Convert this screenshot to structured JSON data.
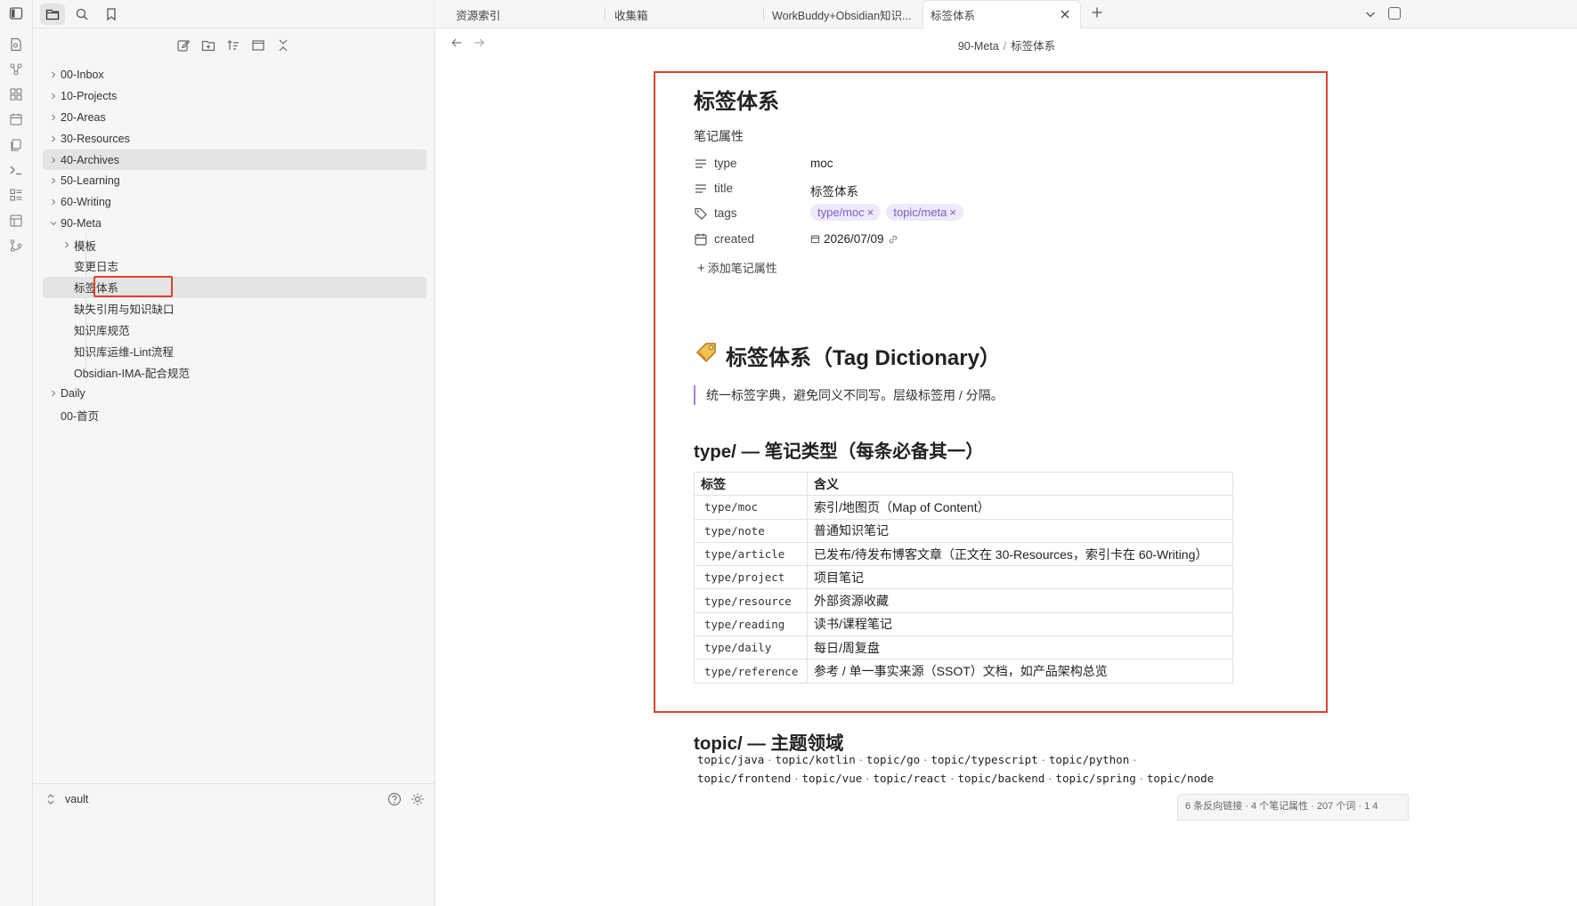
{
  "sidebar": {
    "tree": [
      {
        "label": "00-Inbox",
        "type": "folder",
        "expanded": false
      },
      {
        "label": "10-Projects",
        "type": "folder",
        "expanded": false
      },
      {
        "label": "20-Areas",
        "type": "folder",
        "expanded": false
      },
      {
        "label": "30-Resources",
        "type": "folder",
        "expanded": false
      },
      {
        "label": "40-Archives",
        "type": "folder",
        "expanded": false,
        "selected": true
      },
      {
        "label": "50-Learning",
        "type": "folder",
        "expanded": false
      },
      {
        "label": "60-Writing",
        "type": "folder",
        "expanded": false
      },
      {
        "label": "90-Meta",
        "type": "folder",
        "expanded": true
      },
      {
        "label": "模板",
        "type": "folder",
        "expanded": false,
        "child": true
      },
      {
        "label": "变更日志",
        "type": "file",
        "child": true
      },
      {
        "label": "标签体系",
        "type": "file",
        "child": true,
        "active": true
      },
      {
        "label": "缺失引用与知识缺口",
        "type": "file",
        "child": true
      },
      {
        "label": "知识库规范",
        "type": "file",
        "child": true
      },
      {
        "label": "知识库运维-Lint流程",
        "type": "file",
        "child": true
      },
      {
        "label": "Obsidian-IMA-配合规范",
        "type": "file",
        "child": true
      },
      {
        "label": "Daily",
        "type": "folder",
        "expanded": false
      },
      {
        "label": "00-首页",
        "type": "file"
      }
    ],
    "vault_name": "vault"
  },
  "tabs": [
    {
      "label": "资源索引"
    },
    {
      "label": "收集箱"
    },
    {
      "label": "WorkBuddy+Obsidian知识..."
    },
    {
      "label": "标签体系",
      "active": true
    }
  ],
  "breadcrumb": {
    "folder": "90-Meta",
    "separator": "/",
    "file": "标签体系"
  },
  "note": {
    "title": "标签体系",
    "properties_heading": "笔记属性",
    "properties": {
      "type": {
        "key": "type",
        "value": "moc"
      },
      "title": {
        "key": "title",
        "value": "标签体系"
      },
      "tags": {
        "key": "tags",
        "values": [
          "type/moc",
          "topic/meta"
        ]
      },
      "created": {
        "key": "created",
        "value": "2026/07/09"
      }
    },
    "add_property_label": "添加笔记属性",
    "h1": "标签体系（Tag Dictionary）",
    "quote": "统一标签字典，避免同义不同写。层级标签用 / 分隔。",
    "h2_type": "type/ — 笔记类型（每条必备其一）",
    "table": {
      "headers": [
        "标签",
        "含义"
      ],
      "rows": [
        [
          "type/moc",
          "索引/地图页（Map of Content）"
        ],
        [
          "type/note",
          "普通知识笔记"
        ],
        [
          "type/article",
          "已发布/待发布博客文章（正文在 30-Resources，索引卡在 60-Writing）"
        ],
        [
          "type/project",
          "项目笔记"
        ],
        [
          "type/resource",
          "外部资源收藏"
        ],
        [
          "type/reading",
          "读书/课程笔记"
        ],
        [
          "type/daily",
          "每日/周复盘"
        ],
        [
          "type/reference",
          "参考 / 单一事实来源（SSOT）文档，如产品架构总览"
        ]
      ]
    },
    "h2_topic": "topic/ — 主题领域",
    "topics_line1": [
      "topic/java",
      "topic/kotlin",
      "topic/go",
      "topic/typescript",
      "topic/python"
    ],
    "topics_line2": [
      "topic/frontend",
      "topic/vue",
      "topic/react",
      "topic/backend",
      "topic/spring",
      "topic/node"
    ]
  },
  "status_bar": "6 条反向链接 · 4 个笔记属性 · 207 个词 · 1 4",
  "colors": {
    "accent": "#7c5dcc",
    "highlight_frame": "#d9432f",
    "tag_bg": "#efe9fb"
  }
}
